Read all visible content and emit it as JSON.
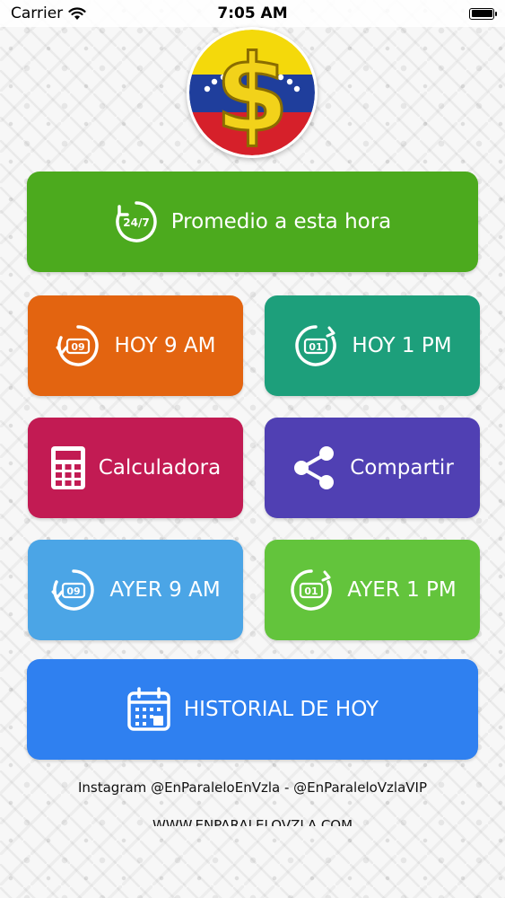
{
  "status_bar": {
    "carrier": "Carrier",
    "time": "7:05 AM"
  },
  "colors": {
    "promedio": "#4caa1e",
    "hoy9": "#e36410",
    "hoy1": "#1d9f7b",
    "calculadora": "#c21b53",
    "compartir": "#5040b3",
    "ayer9": "#4ba5e6",
    "ayer1": "#63c43c",
    "historial": "#2f80f0"
  },
  "buttons": {
    "promedio": {
      "label": "Promedio a esta hora",
      "icon": "clock-24-7-icon",
      "icon_text": "24/7"
    },
    "hoy9": {
      "label": "HOY 9 AM",
      "icon": "clock-09-icon",
      "icon_text": "09"
    },
    "hoy1": {
      "label": "HOY 1 PM",
      "icon": "clock-01-icon",
      "icon_text": "01"
    },
    "calculadora": {
      "label": "Calculadora",
      "icon": "calculator-icon"
    },
    "compartir": {
      "label": "Compartir",
      "icon": "share-icon"
    },
    "ayer9": {
      "label": "AYER 9 AM",
      "icon": "clock-09-icon",
      "icon_text": "09"
    },
    "ayer1": {
      "label": "AYER 1 PM",
      "icon": "clock-01-icon",
      "icon_text": "01"
    },
    "historial": {
      "label": "HISTORIAL DE HOY",
      "icon": "calendar-icon"
    }
  },
  "footer": {
    "instagram": "Instagram @EnParaleloEnVzla - @EnParaleloVzlaVIP",
    "website": "WWW.ENPARALELOVZLA.COM"
  }
}
